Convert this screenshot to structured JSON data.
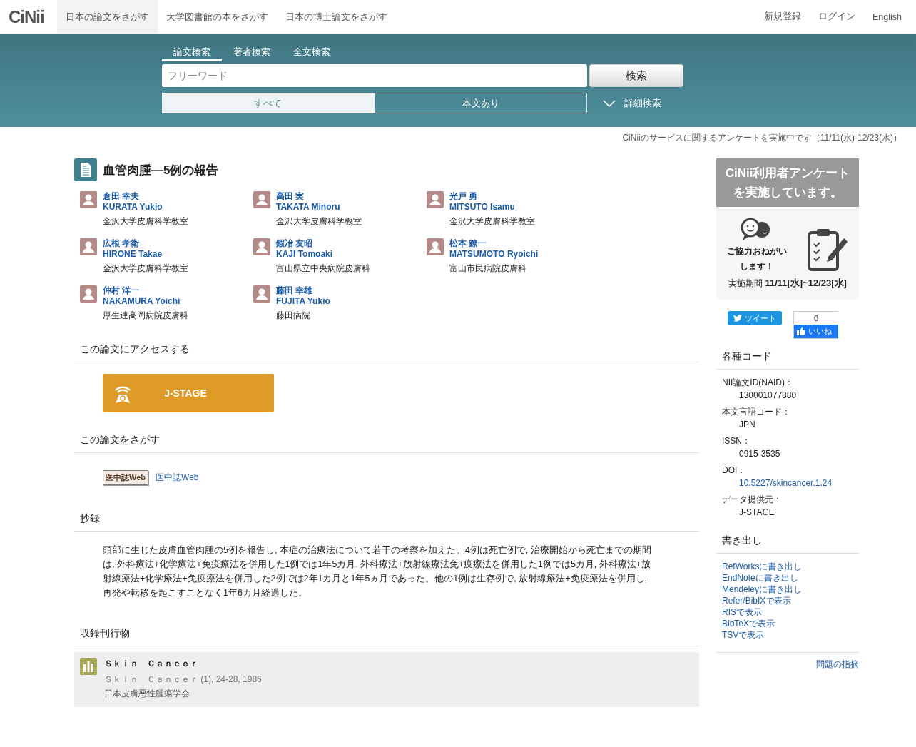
{
  "nav": {
    "logo": "CiNii",
    "tabs": [
      {
        "label": "日本の論文をさがす",
        "selected": true
      },
      {
        "label": "大学図書館の本をさがす",
        "selected": false
      },
      {
        "label": "日本の博士論文をさがす",
        "selected": false
      }
    ],
    "links": [
      "新規登録",
      "ログイン",
      "English"
    ]
  },
  "search": {
    "tabs": [
      {
        "label": "論文検索",
        "selected": true
      },
      {
        "label": "著者検索",
        "selected": false
      },
      {
        "label": "全文検索",
        "selected": false
      }
    ],
    "placeholder": "フリーワード",
    "button": "検索",
    "scopes": [
      {
        "label": "すべて",
        "selected": true
      },
      {
        "label": "本文あり",
        "selected": false
      }
    ],
    "advanced": "詳細検索"
  },
  "notice": "CiNiiのサービスに関するアンケートを実施中です（11/11(水)-12/23(水)）",
  "article": {
    "title": "血管肉腫―5例の報告",
    "authors": [
      {
        "name": "倉田 幸夫",
        "romaji": "KURATA Yukio",
        "affiliation": "金沢大学皮膚科学教室"
      },
      {
        "name": "高田 実",
        "romaji": "TAKATA Minoru",
        "affiliation": "金沢大学皮膚科学教室"
      },
      {
        "name": "光戸 勇",
        "romaji": "MITSUTO Isamu",
        "affiliation": "金沢大学皮膚科学教室"
      },
      {
        "name": "広根 孝衛",
        "romaji": "HIRONE Takae",
        "affiliation": "金沢大学皮膚科学教室"
      },
      {
        "name": "鍜冶 友昭",
        "romaji": "KAJI Tomoaki",
        "affiliation": "富山県立中央病院皮膚科"
      },
      {
        "name": "松本 鐐一",
        "romaji": "MATSUMOTO Ryoichi",
        "affiliation": "富山市民病院皮膚科"
      },
      {
        "name": "仲村 洋一",
        "romaji": "NAKAMURA Yoichi",
        "affiliation": "厚生連高岡病院皮膚科"
      },
      {
        "name": "藤田 幸雄",
        "romaji": "FUJITA Yukio",
        "affiliation": "藤田病院"
      }
    ]
  },
  "access": {
    "heading": "この論文にアクセスする",
    "button": "J-STAGE"
  },
  "find": {
    "heading": "この論文をさがす",
    "badge": "医中誌Web",
    "link": "医中誌Web"
  },
  "abstract": {
    "heading": "抄録",
    "text": "頭部に生じた皮膚血管肉腫の5例を報告し, 本症の治療法について若干の考察を加えた。4例は死亡例で, 治療開始から死亡までの期間は, 外科療法+化学療法+免疫療法を併用した1例では1年5カ月, 外科療法+放射線療法免+疫療法を併用した1例では5カ月, 外科療法+放射線療法+化学療法+免疫療法を併用した2例では2年1カ月と1年5ヵ月であった。他の1例は生存例で, 放射線療法+免疫療法を併用し, 再発や転移を起こすことなく1年6カ月経過した。"
  },
  "journal": {
    "heading": "収録刊行物",
    "title": "Ｓｋｉｎ　Ｃａｎｃｅｒ",
    "subtitle": "Ｓｋｉｎ　Ｃａｎｃｅｒ",
    "detail": "(1), 24-28, 1986",
    "publisher": "日本皮膚悪性腫瘍学会"
  },
  "sidebar": {
    "banner": {
      "title": [
        "CiNii利用者アンケート",
        "を実施しています。"
      ],
      "caption": [
        "ご協力おねがい",
        "します！"
      ],
      "period_label": "実施期間",
      "period": "11/11[水]~12/23[水]"
    },
    "tweet": "ツイート",
    "like_count": "0",
    "like": "いいね",
    "codes": {
      "heading": "各種コード",
      "items": [
        {
          "label": "NII論文ID(NAID)：",
          "value": "130001077880",
          "kind": "text"
        },
        {
          "label": "本文言語コード：",
          "value": "JPN",
          "kind": "text"
        },
        {
          "label": "ISSN：",
          "value": "0915-3535",
          "kind": "text"
        },
        {
          "label": "DOI：",
          "value": "10.5227/skincancer.1.24",
          "kind": "link"
        },
        {
          "label": "データ提供元：",
          "value": "J-STAGE",
          "kind": "text"
        }
      ]
    },
    "export": {
      "heading": "書き出し",
      "links": [
        "RefWorksに書き出し",
        "EndNoteに書き出し",
        "Mendeleyに書き出し",
        "Refer/BibIXで表示",
        "RISで表示",
        "BibTeXで表示",
        "TSVで表示"
      ]
    },
    "report": "問題の指摘"
  }
}
